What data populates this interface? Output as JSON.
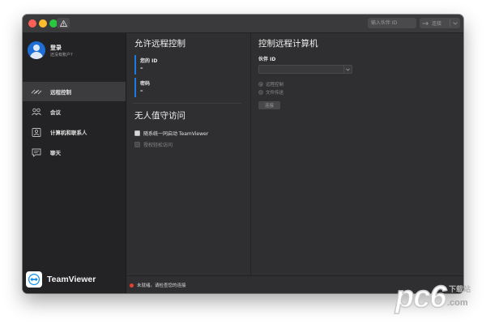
{
  "titlebar": {
    "partner_id_placeholder": "输入伙伴 ID",
    "connect_label": "连接"
  },
  "sidebar": {
    "profile": {
      "title": "登录",
      "subtitle": "还没有账户?"
    },
    "items": [
      {
        "label": "远程控制",
        "icon": "remote-control-icon",
        "active": true
      },
      {
        "label": "会议",
        "icon": "meeting-icon",
        "active": false
      },
      {
        "label": "计算机和联系人",
        "icon": "contacts-icon",
        "active": false
      },
      {
        "label": "聊天",
        "icon": "chat-icon",
        "active": false
      }
    ],
    "brand": "TeamViewer"
  },
  "allow_remote": {
    "title": "允许远程控制",
    "your_id_label": "您的 ID",
    "your_id_value": "–",
    "password_label": "密码",
    "password_value": "–"
  },
  "unattended": {
    "title": "无人值守访问",
    "start_with_system": "随系统一同启动 TeamViewer",
    "grant_easy_access": "授权轻松访问"
  },
  "control_remote": {
    "title": "控制远程计算机",
    "partner_id_label": "伙伴 ID",
    "partner_id_value": "",
    "options": [
      {
        "label": "远程控制",
        "selected": true
      },
      {
        "label": "文件传送",
        "selected": false
      }
    ],
    "connect_button": "连接"
  },
  "status": {
    "text": "未就绪。请检查您的连接",
    "color": "#e8402f"
  },
  "colors": {
    "accent": "#1f7ae0",
    "window_bg": "#2f2f31",
    "sidebar_bg": "#232325"
  },
  "watermark": {
    "main": "pc6",
    "cn": "下载站",
    "domain": ".com"
  }
}
